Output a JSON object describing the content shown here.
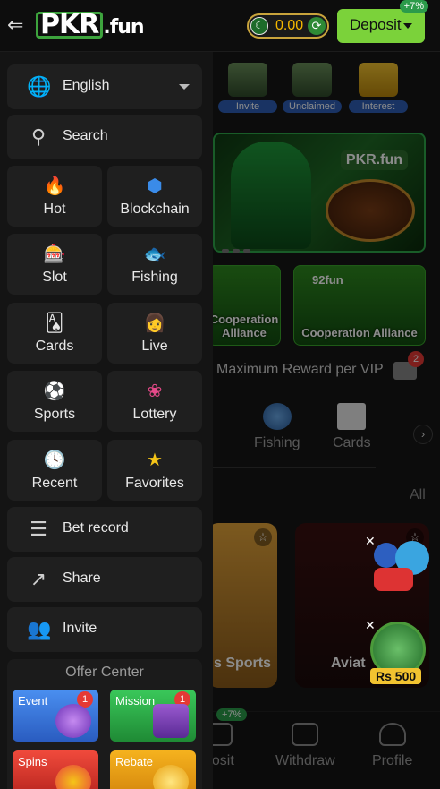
{
  "header": {
    "brand": "PKR",
    "brand_suffix": ".fun",
    "balance": "0.00",
    "deposit_label": "Deposit",
    "deposit_badge": "+7%",
    "back_icon": "arrow-back-icon",
    "flag_icon": "pakistan-flag-icon",
    "refresh_icon": "refresh-icon"
  },
  "drawer": {
    "language": {
      "label": "English",
      "icon": "globe-icon"
    },
    "search": {
      "label": "Search",
      "icon": "search-icon"
    },
    "categories": [
      {
        "label": "Hot",
        "icon": "fire-icon"
      },
      {
        "label": "Blockchain",
        "icon": "blockchain-icon"
      },
      {
        "label": "Slot",
        "icon": "slot-machine-icon"
      },
      {
        "label": "Fishing",
        "icon": "fish-icon"
      },
      {
        "label": "Cards",
        "icon": "playing-cards-icon"
      },
      {
        "label": "Live",
        "icon": "live-dealer-icon"
      },
      {
        "label": "Sports",
        "icon": "soccer-ball-icon"
      },
      {
        "label": "Lottery",
        "icon": "lottery-wheel-icon"
      },
      {
        "label": "Recent",
        "icon": "clock-icon"
      },
      {
        "label": "Favorites",
        "icon": "star-icon"
      }
    ],
    "links": [
      {
        "label": "Bet record",
        "icon": "bet-record-icon"
      },
      {
        "label": "Share",
        "icon": "share-icon"
      },
      {
        "label": "Invite",
        "icon": "invite-icon"
      }
    ],
    "offer_center": {
      "title": "Offer Center",
      "cards": [
        {
          "label": "Event",
          "badge": "1",
          "color": "#3b7be0"
        },
        {
          "label": "Mission",
          "badge": "1",
          "color": "#2fb34a"
        },
        {
          "label": "Spins",
          "badge": "",
          "color": "#e8413c"
        },
        {
          "label": "Rebate",
          "badge": "",
          "color": "#f0a11a"
        }
      ]
    }
  },
  "main": {
    "quick_links": [
      "Invite",
      "Unclaimed",
      "Interest"
    ],
    "banner_brand": "PKR.fun",
    "cooperation": [
      "Cooperation Alliance",
      "Cooperation Alliance"
    ],
    "coop_brands": [
      "92fun"
    ],
    "vip_text": "Maximum Reward per VIP",
    "mail_badge": "2",
    "categories": [
      "Fishing",
      "Cards"
    ],
    "all_label": "All",
    "games": [
      "s Sports",
      "Aviat"
    ],
    "rs_widget": "Rs 500",
    "bottom_nav": [
      {
        "label": "posit",
        "badge": "+7%"
      },
      {
        "label": "Withdraw",
        "badge": ""
      },
      {
        "label": "Profile",
        "badge": ""
      }
    ]
  },
  "colors": {
    "accent_green": "#7bd23a",
    "balance_gold": "#f5b800",
    "badge_red": "#e53935"
  }
}
